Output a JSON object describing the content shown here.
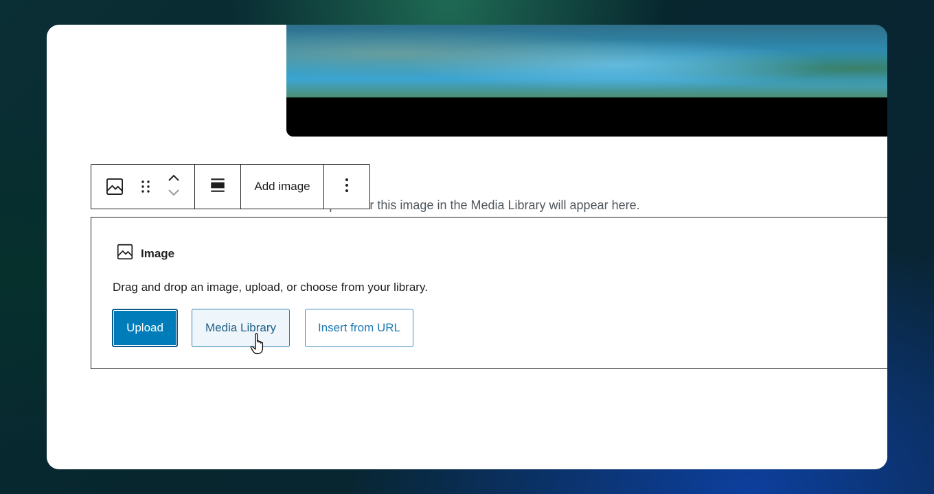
{
  "photo": {
    "alt": "lake photo"
  },
  "caption": {
    "text": "Your caption for this image in the Media Library will appear here."
  },
  "toolbar": {
    "block_icon": "image-icon",
    "drag_icon": "drag-handle-icon",
    "move_up_icon": "chevron-up-icon",
    "move_down_icon": "chevron-down-icon",
    "align_icon": "align-center-icon",
    "add_image_label": "Add image",
    "options_icon": "more-vertical-icon"
  },
  "placeholder": {
    "title": "Image",
    "instructions": "Drag and drop an image, upload, or choose from your library.",
    "upload_label": "Upload",
    "media_library_label": "Media Library",
    "insert_url_label": "Insert from URL"
  },
  "colors": {
    "primary": "#007cba",
    "text": "#1e1e1e",
    "muted": "#50575e"
  }
}
